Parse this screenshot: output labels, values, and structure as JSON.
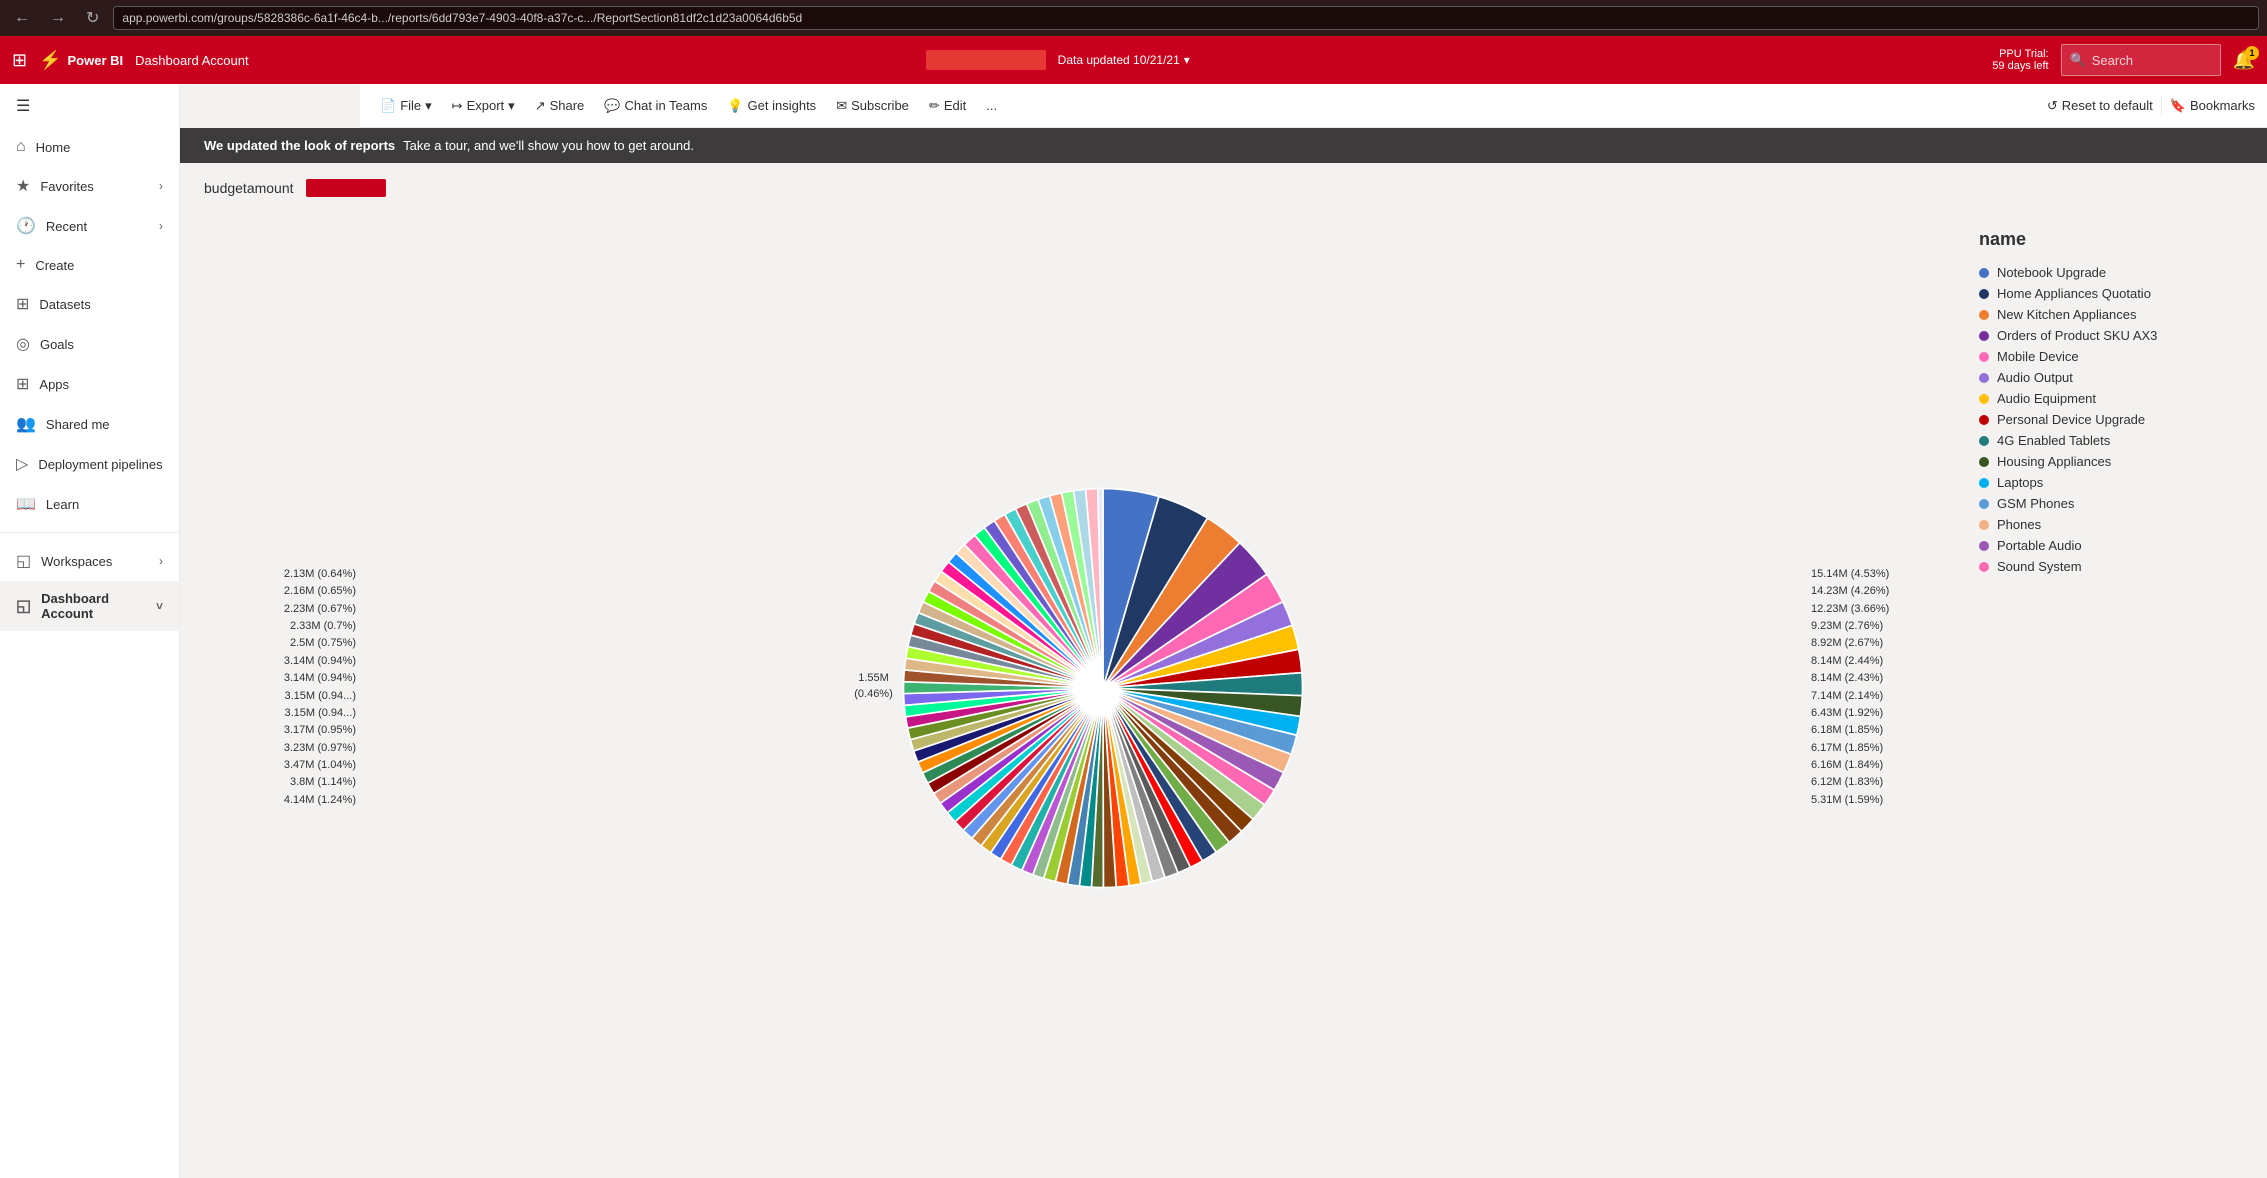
{
  "browser": {
    "url": "app.powerbi.com/groups/5828386c-6a1f-46c4-b.../reports/6dd793e7-4903-40f8-a37c-c.../ReportSection81df2c1d23a0064d6b5d"
  },
  "topbar": {
    "logo": "Power BI",
    "title": "Dashboard Account",
    "data_updated": "Data updated 10/21/21",
    "ppu_trial": "PPU Trial:",
    "ppu_days": "59 days left",
    "search_placeholder": "Search",
    "bell_count": "1"
  },
  "toolbar": {
    "file_label": "File",
    "export_label": "Export",
    "share_label": "Share",
    "chat_label": "Chat in Teams",
    "insights_label": "Get insights",
    "subscribe_label": "Subscribe",
    "edit_label": "Edit",
    "more_label": "...",
    "reset_label": "Reset to default",
    "bookmarks_label": "Bookmarks"
  },
  "sidebar": {
    "hamburger": "☰",
    "items": [
      {
        "id": "home",
        "label": "Home",
        "icon": "⌂",
        "has_chevron": false
      },
      {
        "id": "favorites",
        "label": "Favorites",
        "icon": "★",
        "has_chevron": true
      },
      {
        "id": "recent",
        "label": "Recent",
        "icon": "🕐",
        "has_chevron": true
      },
      {
        "id": "create",
        "label": "Create",
        "icon": "+",
        "has_chevron": false
      },
      {
        "id": "datasets",
        "label": "Datasets",
        "icon": "⊞",
        "has_chevron": false
      },
      {
        "id": "goals",
        "label": "Goals",
        "icon": "◎",
        "has_chevron": false
      },
      {
        "id": "apps",
        "label": "Apps",
        "icon": "⊞",
        "has_chevron": false
      },
      {
        "id": "shared",
        "label": "Shared me",
        "icon": "👥",
        "has_chevron": false
      },
      {
        "id": "deployment",
        "label": "Deployment pipelines",
        "icon": "▷",
        "has_chevron": false
      },
      {
        "id": "learn",
        "label": "Learn",
        "icon": "📖",
        "has_chevron": false
      },
      {
        "id": "workspaces",
        "label": "Workspaces",
        "icon": "◱",
        "has_chevron": true
      },
      {
        "id": "dashboard",
        "label": "Dashboard Account",
        "icon": "◱",
        "has_chevron": true
      }
    ]
  },
  "banner": {
    "title": "We updated the look of reports",
    "text": "Take a tour, and we'll show you how to get around."
  },
  "chart": {
    "title": "budgetamount",
    "legend_title": "name",
    "left_labels": [
      "2.13M (0.64%)",
      "2.16M (0.65%)",
      "2.23M (0.67%)",
      "2.33M (0.7%)",
      "2.5M (0.75%)",
      "3.14M (0.94%)",
      "3.14M (0.94%)",
      "3.15M (0.94...)",
      "3.15M (0.94...)",
      "3.17M (0.95%)",
      "3.23M (0.97%)",
      "3.47M (1.04%)",
      "3.8M (1.14%)",
      "4.14M (1.24%)"
    ],
    "top_labels": [
      "1.55M",
      "(0.46%)"
    ],
    "right_labels": [
      "15.14M (4.53%)",
      "14.23M (4.26%)",
      "12.23M (3.66%)",
      "9.23M (2.76%)",
      "8.92M (2.67%)",
      "8.14M (2.44%)",
      "8.14M (2.43%)",
      "7.14M (2.14%)",
      "6.43M (1.92%)",
      "6.18M (1.85%)",
      "6.17M (1.85%)",
      "6.16M (1.84%)",
      "6.12M (1.83%)",
      "5.31M (1.59%)"
    ],
    "top_right_label": "2.13M (0.64%)",
    "legend_items": [
      {
        "label": "Notebook Upgrade",
        "color": "#4472C4"
      },
      {
        "label": "Home Appliances Quotatio",
        "color": "#203864"
      },
      {
        "label": "New Kitchen Appliances",
        "color": "#ED7D31"
      },
      {
        "label": "Orders of Product SKU AX3",
        "color": "#7030A0"
      },
      {
        "label": "Mobile Device",
        "color": "#FF69B4"
      },
      {
        "label": "Audio Output",
        "color": "#9370DB"
      },
      {
        "label": "Audio Equipment",
        "color": "#FFC000"
      },
      {
        "label": "Personal Device Upgrade",
        "color": "#C00000"
      },
      {
        "label": "4G Enabled Tablets",
        "color": "#1F7C7C"
      },
      {
        "label": "Housing Appliances",
        "color": "#375623"
      },
      {
        "label": "Laptops",
        "color": "#00B0F0"
      },
      {
        "label": "GSM Phones",
        "color": "#5B9BD5"
      },
      {
        "label": "Phones",
        "color": "#F4B183"
      },
      {
        "label": "Portable Audio",
        "color": "#9B59B6"
      },
      {
        "label": "Sound System",
        "color": "#FF69B4"
      }
    ]
  },
  "pie_slices": [
    {
      "color": "#4472C4",
      "start": 0,
      "end": 16.3
    },
    {
      "color": "#203864",
      "start": 16.3,
      "end": 31.6
    },
    {
      "color": "#ED7D31",
      "start": 31.6,
      "end": 43.3
    },
    {
      "color": "#7030A0",
      "start": 43.3,
      "end": 55.2
    },
    {
      "color": "#FF69B4",
      "start": 55.2,
      "end": 64.4
    },
    {
      "color": "#9370DB",
      "start": 64.4,
      "end": 71.7
    },
    {
      "color": "#FFC000",
      "start": 71.7,
      "end": 78.8
    },
    {
      "color": "#C00000",
      "start": 78.8,
      "end": 85.6
    },
    {
      "color": "#1F7C7C",
      "start": 85.6,
      "end": 92.2
    },
    {
      "color": "#375623",
      "start": 92.2,
      "end": 98.2
    },
    {
      "color": "#00B0F0",
      "start": 98.2,
      "end": 103.7
    },
    {
      "color": "#5B9BD5",
      "start": 103.7,
      "end": 109.4
    },
    {
      "color": "#F4B183",
      "start": 109.4,
      "end": 115.1
    },
    {
      "color": "#9B59B6",
      "start": 115.1,
      "end": 120.8
    },
    {
      "color": "#FF69B4",
      "start": 120.8,
      "end": 125.9
    },
    {
      "color": "#A9D18E",
      "start": 125.9,
      "end": 131.2
    },
    {
      "color": "#833C00",
      "start": 131.2,
      "end": 136.0
    },
    {
      "color": "#843C0C",
      "start": 136.0,
      "end": 140.7
    },
    {
      "color": "#70AD47",
      "start": 140.7,
      "end": 145.4
    },
    {
      "color": "#264478",
      "start": 145.4,
      "end": 150.1
    },
    {
      "color": "#FF0000",
      "start": 150.1,
      "end": 154.0
    },
    {
      "color": "#595959",
      "start": 154.0,
      "end": 157.9
    },
    {
      "color": "#7F7F7F",
      "start": 157.9,
      "end": 161.9
    },
    {
      "color": "#BFBFBF",
      "start": 161.9,
      "end": 165.7
    },
    {
      "color": "#D6E4BC",
      "start": 165.7,
      "end": 169.0
    },
    {
      "color": "#FFA500",
      "start": 169.0,
      "end": 172.5
    },
    {
      "color": "#FF4500",
      "start": 172.5,
      "end": 176.2
    },
    {
      "color": "#8B4513",
      "start": 176.2,
      "end": 179.9
    },
    {
      "color": "#556B2F",
      "start": 179.9,
      "end": 183.3
    },
    {
      "color": "#008B8B",
      "start": 183.3,
      "end": 186.8
    },
    {
      "color": "#4682B4",
      "start": 186.8,
      "end": 190.3
    },
    {
      "color": "#D2691E",
      "start": 190.3,
      "end": 193.8
    },
    {
      "color": "#9ACD32",
      "start": 193.8,
      "end": 197.3
    },
    {
      "color": "#8FBC8F",
      "start": 197.3,
      "end": 200.6
    },
    {
      "color": "#BA55D3",
      "start": 200.6,
      "end": 204.0
    },
    {
      "color": "#20B2AA",
      "start": 204.0,
      "end": 207.4
    },
    {
      "color": "#FF6347",
      "start": 207.4,
      "end": 210.9
    },
    {
      "color": "#4169E1",
      "start": 210.9,
      "end": 214.3
    },
    {
      "color": "#DAA520",
      "start": 214.3,
      "end": 217.7
    },
    {
      "color": "#CD853F",
      "start": 217.7,
      "end": 221.1
    },
    {
      "color": "#6495ED",
      "start": 221.1,
      "end": 224.5
    },
    {
      "color": "#DC143C",
      "start": 224.5,
      "end": 227.9
    },
    {
      "color": "#00CED1",
      "start": 227.9,
      "end": 231.3
    },
    {
      "color": "#9932CC",
      "start": 231.3,
      "end": 234.7
    },
    {
      "color": "#E9967A",
      "start": 234.7,
      "end": 238.1
    },
    {
      "color": "#8B0000",
      "start": 238.1,
      "end": 241.5
    },
    {
      "color": "#2E8B57",
      "start": 241.5,
      "end": 244.8
    },
    {
      "color": "#FF8C00",
      "start": 244.8,
      "end": 248.2
    },
    {
      "color": "#191970",
      "start": 248.2,
      "end": 251.6
    },
    {
      "color": "#BDB76B",
      "start": 251.6,
      "end": 255.0
    },
    {
      "color": "#6B8E23",
      "start": 255.0,
      "end": 258.4
    },
    {
      "color": "#C71585",
      "start": 258.4,
      "end": 261.7
    },
    {
      "color": "#00FA9A",
      "start": 261.7,
      "end": 265.0
    },
    {
      "color": "#7B68EE",
      "start": 265.0,
      "end": 268.4
    },
    {
      "color": "#3CB371",
      "start": 268.4,
      "end": 271.8
    },
    {
      "color": "#A0522D",
      "start": 271.8,
      "end": 275.2
    },
    {
      "color": "#DEB887",
      "start": 275.2,
      "end": 278.6
    },
    {
      "color": "#ADFF2F",
      "start": 278.6,
      "end": 282.0
    },
    {
      "color": "#778899",
      "start": 282.0,
      "end": 285.4
    },
    {
      "color": "#B22222",
      "start": 285.4,
      "end": 288.8
    },
    {
      "color": "#5F9EA0",
      "start": 288.8,
      "end": 292.2
    },
    {
      "color": "#D2B48C",
      "start": 292.2,
      "end": 295.6
    },
    {
      "color": "#7CFC00",
      "start": 295.6,
      "end": 299.0
    },
    {
      "color": "#F08080",
      "start": 299.0,
      "end": 302.4
    },
    {
      "color": "#FFDEAD",
      "start": 302.4,
      "end": 305.8
    },
    {
      "color": "#FF1493",
      "start": 305.8,
      "end": 309.2
    },
    {
      "color": "#1E90FF",
      "start": 309.2,
      "end": 312.6
    },
    {
      "color": "#FFDAB9",
      "start": 312.6,
      "end": 316.0
    },
    {
      "color": "#FF69B4",
      "start": 316.0,
      "end": 320.0
    },
    {
      "color": "#00FF7F",
      "start": 320.0,
      "end": 323.5
    },
    {
      "color": "#6A5ACD",
      "start": 323.5,
      "end": 327.0
    },
    {
      "color": "#FA8072",
      "start": 327.0,
      "end": 330.5
    },
    {
      "color": "#48D1CC",
      "start": 330.5,
      "end": 334.0
    },
    {
      "color": "#CD5C5C",
      "start": 334.0,
      "end": 337.5
    },
    {
      "color": "#90EE90",
      "start": 337.5,
      "end": 341.0
    },
    {
      "color": "#87CEEB",
      "start": 341.0,
      "end": 344.5
    },
    {
      "color": "#FFA07A",
      "start": 344.5,
      "end": 348.0
    },
    {
      "color": "#98FB98",
      "start": 348.0,
      "end": 351.5
    },
    {
      "color": "#ADD8E6",
      "start": 351.5,
      "end": 355.0
    },
    {
      "color": "#FFB6C1",
      "start": 355.0,
      "end": 358.5
    },
    {
      "color": "#E6E6FA",
      "start": 358.5,
      "end": 360.0
    }
  ]
}
